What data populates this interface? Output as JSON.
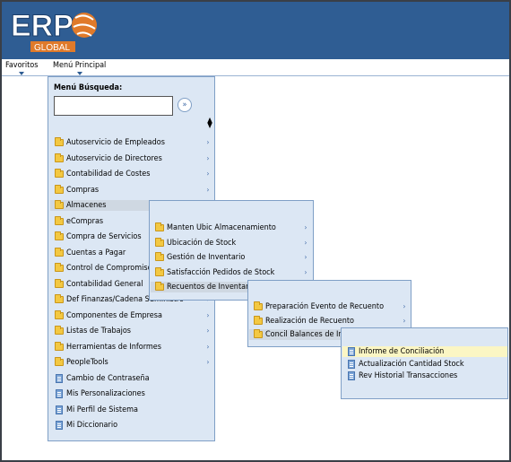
{
  "brand": {
    "logo_text": "ERP",
    "logo_sub": "GLOBAL"
  },
  "topnav": {
    "favoritos": "Favoritos",
    "menu_principal": "Menú Principal"
  },
  "search": {
    "title": "Menú Búsqueda:",
    "value": "",
    "go_icon": "chevron-right-circle-icon",
    "sort_icon": "sort-icon"
  },
  "main_menu": {
    "items": [
      {
        "label": "Autoservicio de Empleados",
        "icon": "folder-icon",
        "submenu": true
      },
      {
        "label": "Autoservicio de Directores",
        "icon": "folder-icon",
        "submenu": true
      },
      {
        "label": "Contabilidad de Costes",
        "icon": "folder-icon",
        "submenu": true
      },
      {
        "label": "Compras",
        "icon": "folder-icon",
        "submenu": true
      },
      {
        "label": "Almacenes",
        "icon": "folder-icon",
        "submenu": true,
        "selected": true
      },
      {
        "label": "eCompras",
        "icon": "folder-icon",
        "submenu": true
      },
      {
        "label": "Compra de Servicios",
        "icon": "folder-icon",
        "submenu": true
      },
      {
        "label": "Cuentas a Pagar",
        "icon": "folder-icon",
        "submenu": true
      },
      {
        "label": "Control de Compromisos",
        "icon": "folder-icon",
        "submenu": true
      },
      {
        "label": "Contabilidad General",
        "icon": "folder-icon",
        "submenu": true
      },
      {
        "label": "Def Finanzas/Cadena Suministro",
        "icon": "folder-icon",
        "submenu": true
      },
      {
        "label": "Componentes de Empresa",
        "icon": "folder-icon",
        "submenu": true
      },
      {
        "label": "Listas de Trabajos",
        "icon": "folder-icon",
        "submenu": true
      },
      {
        "label": "Herramientas de Informes",
        "icon": "folder-icon",
        "submenu": true
      },
      {
        "label": "PeopleTools",
        "icon": "folder-icon",
        "submenu": true
      },
      {
        "label": "Cambio de Contraseña",
        "icon": "document-icon",
        "submenu": false
      },
      {
        "label": "Mis Personalizaciones",
        "icon": "document-icon",
        "submenu": false
      },
      {
        "label": "Mi Perfil de Sistema",
        "icon": "document-icon",
        "submenu": false
      },
      {
        "label": "Mi Diccionario",
        "icon": "document-icon",
        "submenu": false
      }
    ]
  },
  "almacenes_menu": {
    "items": [
      {
        "label": "Manten Ubic Almacenamiento",
        "icon": "folder-icon",
        "submenu": true
      },
      {
        "label": "Ubicación de Stock",
        "icon": "folder-icon",
        "submenu": true
      },
      {
        "label": "Gestión de Inventario",
        "icon": "folder-icon",
        "submenu": true
      },
      {
        "label": "Satisfacción Pedidos de Stock",
        "icon": "folder-icon",
        "submenu": true
      },
      {
        "label": "Recuentos de Inventario",
        "icon": "folder-icon",
        "submenu": true,
        "selected": true
      }
    ]
  },
  "recuentos_menu": {
    "items": [
      {
        "label": "Preparación Evento de Recuento",
        "icon": "folder-icon",
        "submenu": true
      },
      {
        "label": "Realización de Recuento",
        "icon": "folder-icon",
        "submenu": true
      },
      {
        "label": "Concil Balances de Inventario",
        "icon": "folder-icon",
        "submenu": true,
        "selected": true
      }
    ]
  },
  "concil_menu": {
    "items": [
      {
        "label": "Informe de Conciliación",
        "icon": "document-icon",
        "highlighted": true
      },
      {
        "label": "Actualización Cantidad Stock",
        "icon": "document-icon"
      },
      {
        "label": "Rev Historial Transacciones",
        "icon": "document-icon"
      }
    ]
  },
  "colors": {
    "header_blue": "#2f5d93",
    "menu_bg": "#dce7f4",
    "highlight": "#fbf6c4"
  }
}
